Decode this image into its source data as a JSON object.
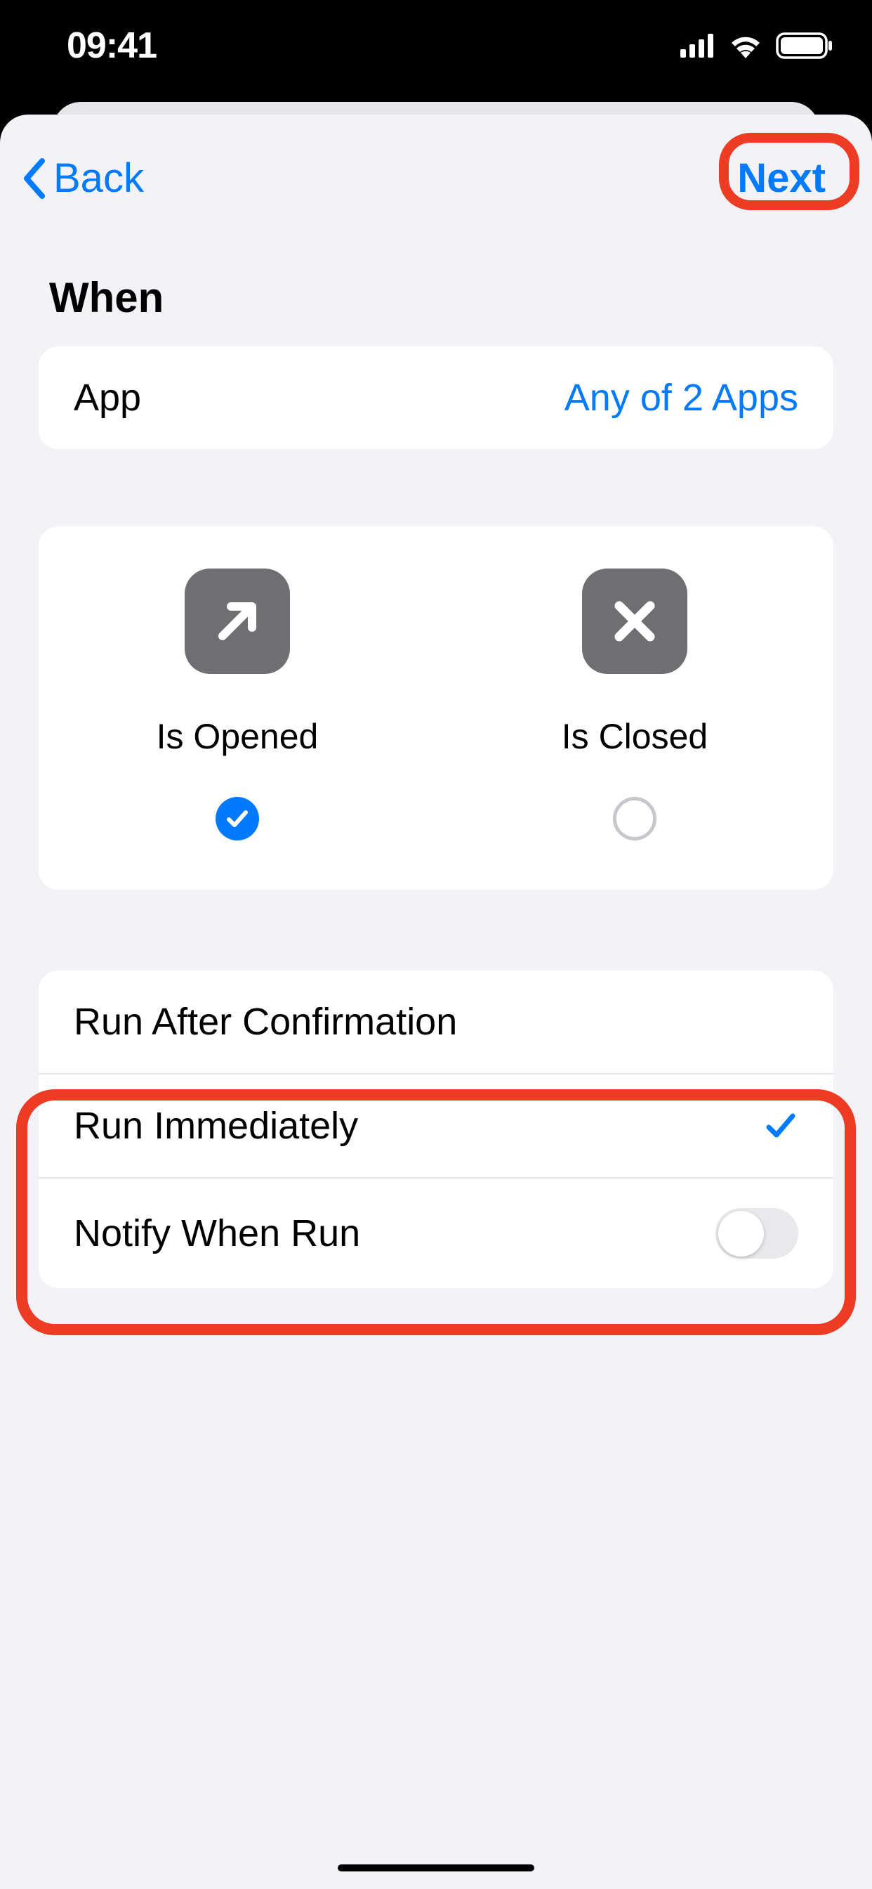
{
  "statusBar": {
    "time": "09:41"
  },
  "nav": {
    "back": "Back",
    "next": "Next"
  },
  "title": "When",
  "appRow": {
    "label": "App",
    "value": "Any of 2 Apps"
  },
  "triggers": {
    "opened": {
      "label": "Is Opened",
      "selected": true
    },
    "closed": {
      "label": "Is Closed",
      "selected": false
    }
  },
  "runOptions": {
    "afterConfirmation": "Run After Confirmation",
    "immediately": "Run Immediately",
    "notify": "Notify When Run",
    "notifyEnabled": false
  }
}
